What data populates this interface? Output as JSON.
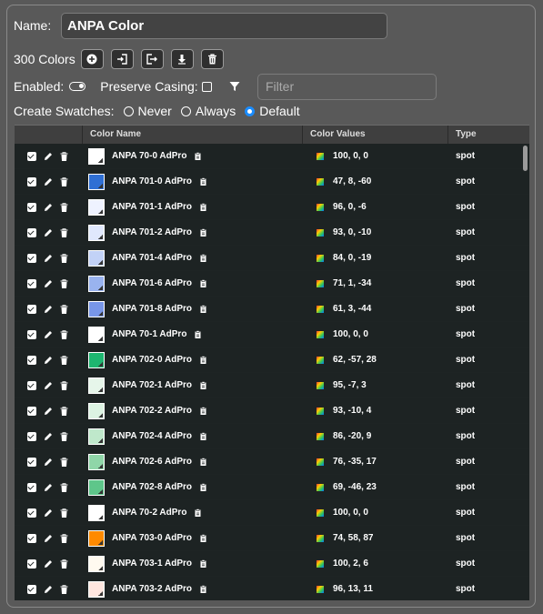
{
  "form": {
    "name_label": "Name:",
    "name_value": "ANPA Color",
    "colors_count": "300 Colors",
    "enabled_label": "Enabled:",
    "preserve_casing_label": "Preserve Casing:",
    "filter_placeholder": "Filter",
    "create_swatches_label": "Create Swatches:",
    "radio_never": "Never",
    "radio_always": "Always",
    "radio_default": "Default",
    "radio_selected": "Default"
  },
  "toolbar_icons": [
    "add-icon",
    "import-icon",
    "export-icon",
    "download-icon",
    "trash-icon"
  ],
  "table": {
    "headers": [
      "Color Name",
      "Color Values",
      "Type"
    ],
    "rows": [
      {
        "name": "ANPA 70-0 AdPro",
        "values": "100, 0, 0",
        "type": "spot",
        "color": "#ffffff"
      },
      {
        "name": "ANPA 701-0 AdPro",
        "values": "47, 8, -60",
        "type": "spot",
        "color": "#2f6fd4"
      },
      {
        "name": "ANPA 701-1 AdPro",
        "values": "96, 0, -6",
        "type": "spot",
        "color": "#eef2ff"
      },
      {
        "name": "ANPA 701-2 AdPro",
        "values": "93, 0, -10",
        "type": "spot",
        "color": "#e0e8fd"
      },
      {
        "name": "ANPA 701-4 AdPro",
        "values": "84, 0, -19",
        "type": "spot",
        "color": "#c2d2f7"
      },
      {
        "name": "ANPA 701-6 AdPro",
        "values": "71, 1, -34",
        "type": "spot",
        "color": "#99b3ef"
      },
      {
        "name": "ANPA 701-8 AdPro",
        "values": "61, 3, -44",
        "type": "spot",
        "color": "#7896e8"
      },
      {
        "name": "ANPA 70-1 AdPro",
        "values": "100, 0, 0",
        "type": "spot",
        "color": "#ffffff"
      },
      {
        "name": "ANPA 702-0 AdPro",
        "values": "62, -57, 28",
        "type": "spot",
        "color": "#1eb670"
      },
      {
        "name": "ANPA 702-1 AdPro",
        "values": "95, -7, 3",
        "type": "spot",
        "color": "#e6f6ea"
      },
      {
        "name": "ANPA 702-2 AdPro",
        "values": "93, -10, 4",
        "type": "spot",
        "color": "#dcf3e2"
      },
      {
        "name": "ANPA 702-4 AdPro",
        "values": "86, -20, 9",
        "type": "spot",
        "color": "#bfe8cb"
      },
      {
        "name": "ANPA 702-6 AdPro",
        "values": "76, -35, 17",
        "type": "spot",
        "color": "#8fd6a8"
      },
      {
        "name": "ANPA 702-8 AdPro",
        "values": "69, -46, 23",
        "type": "spot",
        "color": "#5ec68a"
      },
      {
        "name": "ANPA 70-2 AdPro",
        "values": "100, 0, 0",
        "type": "spot",
        "color": "#ffffff"
      },
      {
        "name": "ANPA 703-0 AdPro",
        "values": "74, 58, 87",
        "type": "spot",
        "color": "#ff8a00"
      },
      {
        "name": "ANPA 703-1 AdPro",
        "values": "100, 2, 6",
        "type": "spot",
        "color": "#fffaf0"
      },
      {
        "name": "ANPA 703-2 AdPro",
        "values": "96, 13, 11",
        "type": "spot",
        "color": "#ffe6df"
      }
    ]
  }
}
